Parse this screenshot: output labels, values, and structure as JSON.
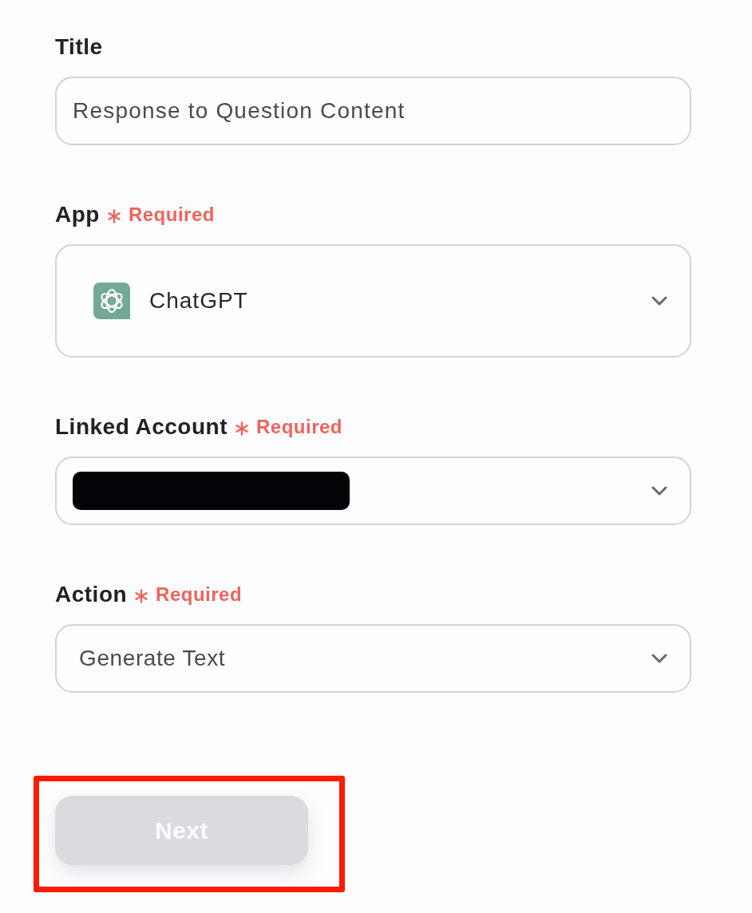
{
  "fields": [
    {
      "kind": "text",
      "label": "Title",
      "required": false,
      "value": "Response to Question Content"
    },
    {
      "kind": "app-select",
      "label": "App",
      "required": true,
      "required_label": "Required",
      "value": "ChatGPT"
    },
    {
      "kind": "select",
      "label": "Linked Account",
      "required": true,
      "required_label": "Required",
      "redacted": true
    },
    {
      "kind": "select",
      "label": "Action",
      "required": true,
      "required_label": "Required",
      "value": "Generate Text"
    }
  ],
  "button": {
    "label": "Next",
    "disabled": true,
    "highlighted": true
  }
}
